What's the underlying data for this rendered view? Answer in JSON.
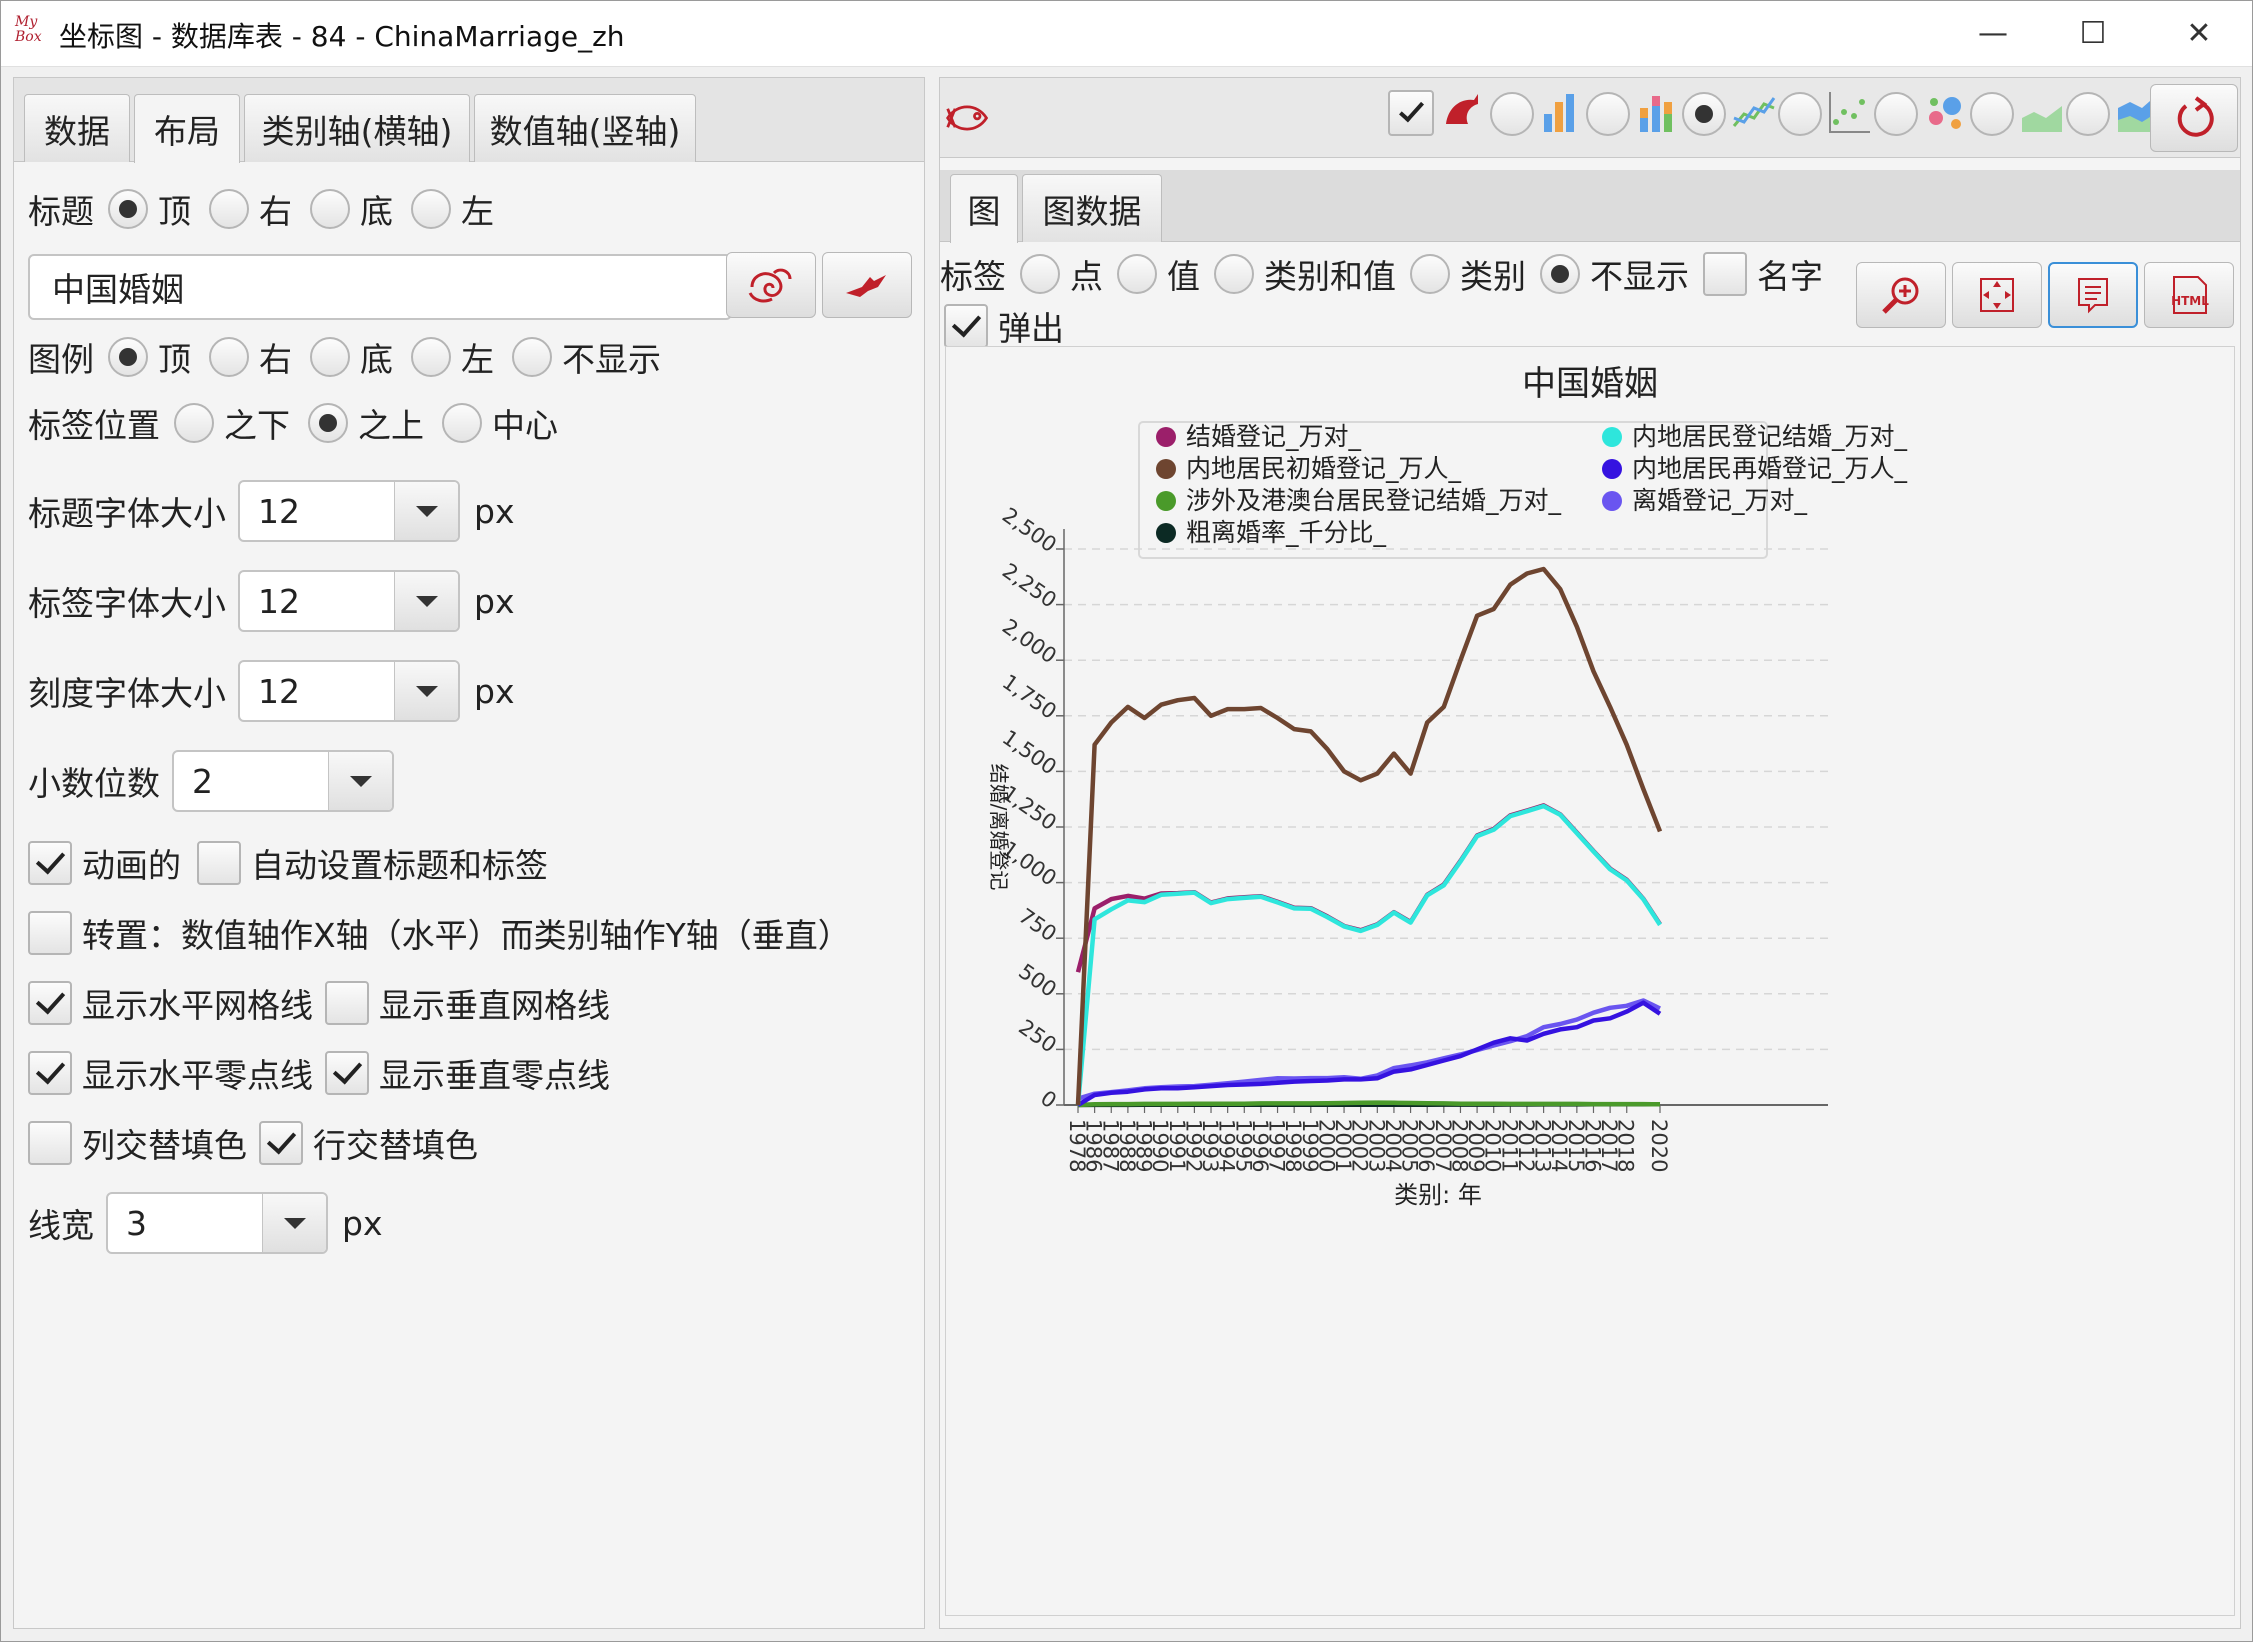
{
  "window": {
    "title": "坐标图 - 数据库表 - 84 - ChinaMarriage_zh",
    "app_icon_text": "My Box",
    "minimize": "—",
    "maximize": "☐",
    "close": "✕"
  },
  "left_tabs": [
    "数据",
    "布局",
    "类别轴(横轴)",
    "数值轴(竖轴)"
  ],
  "selected_left_tab": "布局",
  "title_row": {
    "label": "标题",
    "options": [
      "顶",
      "右",
      "底",
      "左"
    ],
    "selected": "顶"
  },
  "title_input": {
    "value": "中国婚姻"
  },
  "legend_row": {
    "label": "图例",
    "options": [
      "顶",
      "右",
      "底",
      "左",
      "不显示"
    ],
    "selected": "顶"
  },
  "label_pos_row": {
    "label": "标签位置",
    "options": [
      "之下",
      "之上",
      "中心"
    ],
    "selected": "之上"
  },
  "title_font": {
    "label": "标题字体大小",
    "value": "12",
    "unit": "px"
  },
  "label_font": {
    "label": "标签字体大小",
    "value": "12",
    "unit": "px"
  },
  "tick_font": {
    "label": "刻度字体大小",
    "value": "12",
    "unit": "px"
  },
  "decimals": {
    "label": "小数位数",
    "value": "2"
  },
  "checks": {
    "animated": {
      "label": "动画的",
      "checked": true
    },
    "auto_title": {
      "label": "自动设置标题和标签",
      "checked": false
    },
    "transpose": {
      "label": "转置：数值轴作X轴（水平）而类别轴作Y轴（垂直）",
      "checked": false
    },
    "h_grid": {
      "label": "显示水平网格线",
      "checked": true
    },
    "v_grid": {
      "label": "显示垂直网格线",
      "checked": false
    },
    "h_zero": {
      "label": "显示水平零点线",
      "checked": true
    },
    "v_zero": {
      "label": "显示垂直零点线",
      "checked": true
    },
    "col_alt": {
      "label": "列交替填色",
      "checked": false
    },
    "row_alt": {
      "label": "行交替填色",
      "checked": true
    }
  },
  "line_width": {
    "label": "线宽",
    "value": "3",
    "unit": "px"
  },
  "right_tabs": [
    "图",
    "图数据"
  ],
  "selected_right_tab": "图",
  "label_mode": {
    "label": "标签",
    "options": [
      "点",
      "值",
      "类别和值",
      "类别",
      "不显示"
    ],
    "selected": "不显示"
  },
  "name_check": {
    "label": "名字",
    "checked": false
  },
  "popup_check": {
    "label": "弹出",
    "checked": true
  },
  "chart_type_selected": "line",
  "colors": {
    "accent_red": "#c0202a"
  },
  "chart_data": {
    "type": "line",
    "title": "中国婚姻",
    "xlabel": "类别: 年",
    "ylabel": "结婚/离婚登记",
    "ylim": [
      0,
      2500
    ],
    "yticks": [
      "0",
      "250",
      "500",
      "750",
      "1,000",
      "1,250",
      "1,500",
      "1,750",
      "2,000",
      "2,250",
      "2,500"
    ],
    "grid": "horizontal dashed",
    "legend_position": "top",
    "x": [
      "1978",
      "1986",
      "1987",
      "1988",
      "1989",
      "1990",
      "1991",
      "1992",
      "1993",
      "1994",
      "1995",
      "1996",
      "1997",
      "1998",
      "1999",
      "2000",
      "2001",
      "2002",
      "2003",
      "2004",
      "2005",
      "2006",
      "2007",
      "2008",
      "2009",
      "2010",
      "2011",
      "2012",
      "2013",
      "2014",
      "2015",
      "2016",
      "2017",
      "2018",
      "2019",
      "2020"
    ],
    "x_tick_labels": [
      "1978",
      "1986",
      "1987",
      "1988",
      "1989",
      "1990",
      "1991",
      "1992",
      "1993",
      "1994",
      "1995",
      "1996",
      "1997",
      "1998",
      "1999",
      "2000",
      "2001",
      "2002",
      "2003",
      "2004",
      "2005",
      "2006",
      "2007",
      "2008",
      "2009",
      "2010",
      "2011",
      "2012",
      "2013",
      "2014",
      "2015",
      "2016",
      "2017",
      "2018",
      "2020"
    ],
    "series": [
      {
        "name": "结婚登记_万对_",
        "color": "#9b1f6a",
        "values": [
          597,
          884,
          926,
          940,
          928,
          951,
          953,
          957,
          910,
          929,
          934,
          939,
          914,
          887,
          885,
          848,
          805,
          786,
          812,
          867,
          823,
          945,
          991,
          1098,
          1212,
          1241,
          1302,
          1324,
          1347,
          1307,
          1225,
          1142,
          1063,
          1013,
          927,
          813
        ]
      },
      {
        "name": "内地居民登记结婚_万对_",
        "color": "#2ee6dc",
        "values": [
          0,
          835,
          880,
          920,
          912,
          945,
          950,
          955,
          908,
          926,
          931,
          936,
          911,
          884,
          882,
          845,
          803,
          783,
          810,
          865,
          820,
          943,
          988,
          1095,
          1209,
          1238,
          1299,
          1321,
          1344,
          1305,
          1222,
          1140,
          1060,
          1010,
          925,
          810
        ]
      },
      {
        "name": "内地居民初婚登记_万人_",
        "color": "#6e4530",
        "values": [
          0,
          1620,
          1720,
          1790,
          1740,
          1800,
          1820,
          1830,
          1750,
          1780,
          1780,
          1785,
          1740,
          1690,
          1680,
          1600,
          1500,
          1460,
          1490,
          1580,
          1490,
          1720,
          1790,
          2000,
          2200,
          2230,
          2340,
          2390,
          2410,
          2320,
          2150,
          1950,
          1790,
          1620,
          1420,
          1230
        ]
      },
      {
        "name": "内地居民再婚登记_万人_",
        "color": "#3512e0",
        "values": [
          0,
          45,
          55,
          60,
          70,
          75,
          75,
          80,
          85,
          90,
          92,
          95,
          100,
          105,
          108,
          110,
          115,
          115,
          120,
          150,
          160,
          180,
          200,
          220,
          250,
          280,
          300,
          290,
          320,
          340,
          350,
          380,
          390,
          420,
          460,
          410
        ]
      },
      {
        "name": "涉外及港澳台居民登记结婚_万对_",
        "color": "#4a9a2a",
        "values": [
          0,
          3,
          4,
          4,
          5,
          5,
          5,
          6,
          6,
          6,
          6,
          7,
          7,
          7,
          7,
          8,
          9,
          10,
          11,
          10,
          9,
          8,
          7,
          6,
          6,
          6,
          5,
          5,
          5,
          5,
          5,
          4,
          4,
          4,
          4,
          3
        ]
      },
      {
        "name": "离婚登记_万对_",
        "color": "#6a55f0",
        "values": [
          29,
          51,
          58,
          66,
          75,
          80,
          83,
          85,
          91,
          98,
          105,
          113,
          120,
          119,
          121,
          121,
          125,
          118,
          133,
          166,
          178,
          192,
          210,
          227,
          247,
          268,
          287,
          310,
          350,
          364,
          384,
          415,
          437,
          446,
          470,
          434
        ]
      },
      {
        "name": "粗离婚率_千分比_",
        "color": "#0c2a24",
        "values": [
          0.2,
          0.5,
          0.6,
          0.6,
          0.7,
          0.7,
          0.7,
          0.7,
          0.8,
          0.8,
          0.9,
          0.9,
          1.0,
          1.0,
          1.0,
          1.0,
          1.0,
          0.9,
          1.1,
          1.3,
          1.4,
          1.5,
          1.6,
          1.7,
          1.9,
          2.0,
          2.1,
          2.3,
          2.6,
          2.7,
          2.8,
          3.0,
          3.2,
          3.2,
          3.4,
          3.1
        ]
      }
    ]
  }
}
